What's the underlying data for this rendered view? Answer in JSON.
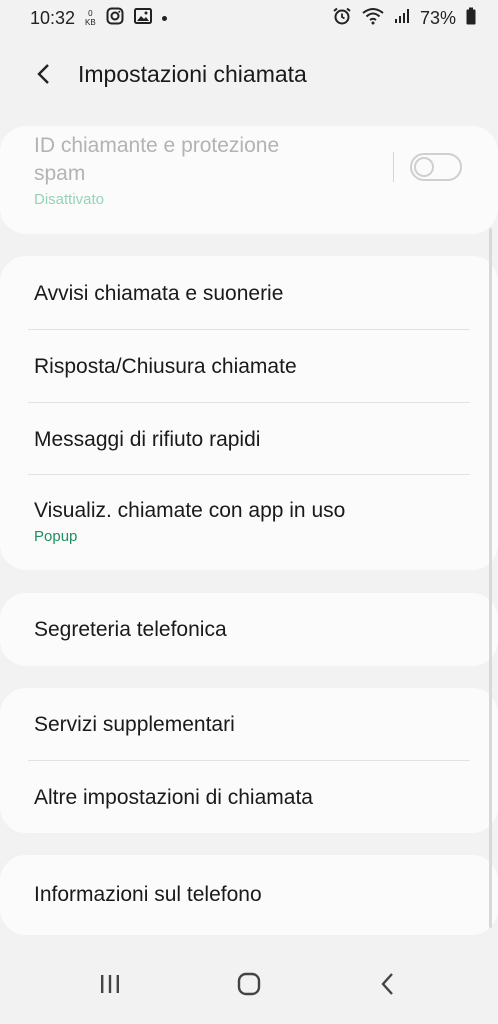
{
  "status_bar": {
    "time": "10:32",
    "data_speed_value": "0",
    "data_speed_unit": "KB",
    "battery": "73%",
    "icons": [
      "instagram-icon",
      "gallery-icon",
      "alarm-icon",
      "wifi-icon",
      "signal-icon",
      "battery-icon"
    ]
  },
  "header": {
    "title": "Impostazioni chiamata"
  },
  "cards": {
    "caller_id": {
      "title_line1": "ID chiamante e protezione",
      "title_line2": "spam",
      "status": "Disattivato",
      "toggle_on": false
    },
    "group1": {
      "items": [
        {
          "label": "Avvisi chiamata e suonerie"
        },
        {
          "label": "Risposta/Chiusura chiamate"
        },
        {
          "label": "Messaggi di rifiuto rapidi"
        },
        {
          "label": "Visualiz. chiamate con app in uso",
          "sub": "Popup"
        }
      ]
    },
    "group2": {
      "items": [
        {
          "label": "Segreteria telefonica"
        }
      ]
    },
    "group3": {
      "items": [
        {
          "label": "Servizi supplementari"
        },
        {
          "label": "Altre impostazioni di chiamata"
        }
      ]
    },
    "group4": {
      "items": [
        {
          "label": "Informazioni sul telefono"
        }
      ]
    }
  },
  "colors": {
    "background": "#f2f2f2",
    "card": "#fbfbfb",
    "accent_green": "#1f8f60",
    "disabled_text": "#b3b3b3"
  },
  "navbar": {
    "icons": [
      "recent-apps-icon",
      "home-icon",
      "back-icon"
    ]
  }
}
